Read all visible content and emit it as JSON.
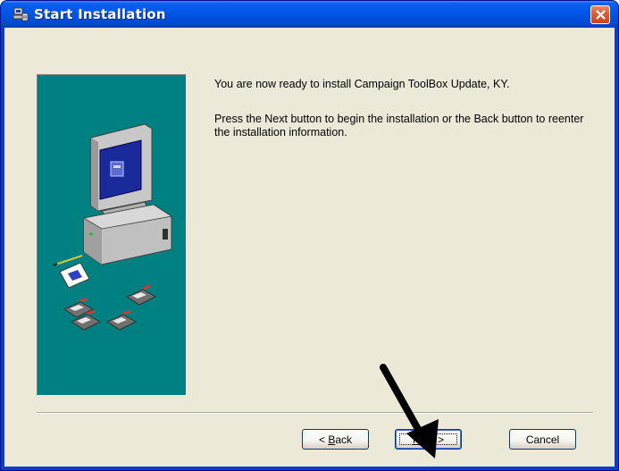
{
  "window": {
    "title": "Start Installation"
  },
  "message": {
    "line1": "You are now ready to install Campaign ToolBox Update, KY.",
    "line2": "Press the Next button to begin the installation or the Back button to reenter the installation information."
  },
  "buttons": {
    "back": {
      "mnemonic": "B",
      "rest": "ack",
      "prefix": "< "
    },
    "next": {
      "mnemonic": "N",
      "rest": "ext",
      "suffix": " >"
    },
    "cancel": "Cancel"
  },
  "colors": {
    "titlebar": "#0055e5",
    "client": "#ece9d8",
    "art_panel": "#008080",
    "close_button": "#d75e38"
  },
  "icons": [
    "setup-icon",
    "close-icon",
    "computer-disks-illustration",
    "pointer-arrow"
  ]
}
